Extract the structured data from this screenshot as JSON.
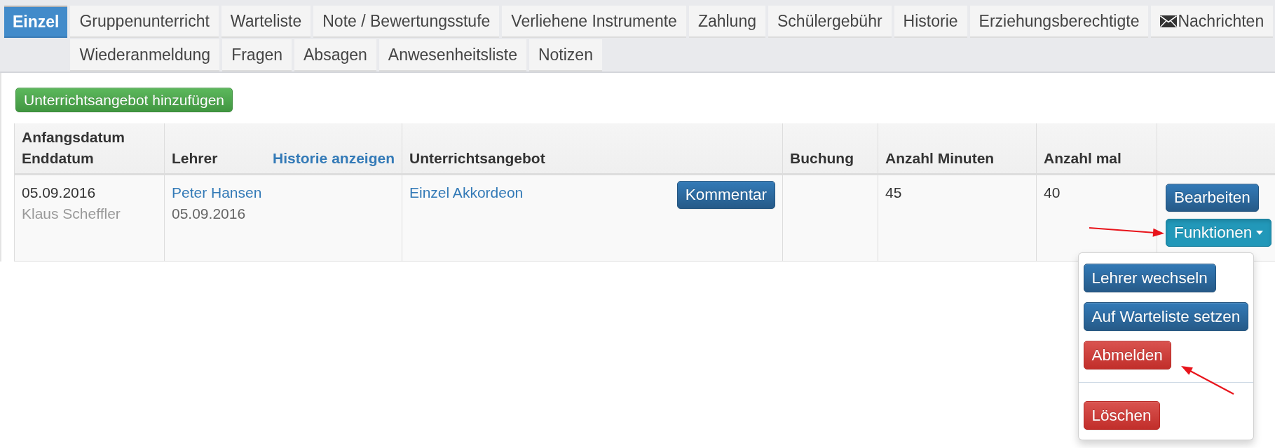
{
  "tab_rows": [
    [
      {
        "label": "Einzel",
        "selected": true,
        "kind": "plain"
      },
      {
        "label": "Gruppenunterricht",
        "selected": false,
        "kind": "plain"
      },
      {
        "label": "Warteliste",
        "selected": false,
        "kind": "plain"
      },
      {
        "label": "Note / Bewertungsstufe",
        "selected": false,
        "kind": "plain"
      },
      {
        "label": "Verliehene Instrumente",
        "selected": false,
        "kind": "plain"
      },
      {
        "label": "Zahlung",
        "selected": false,
        "kind": "plain"
      },
      {
        "label": "Schülergebühr",
        "selected": false,
        "kind": "plain"
      },
      {
        "label": "Historie",
        "selected": false,
        "kind": "plain"
      },
      {
        "label": "Erziehungsberechtigte",
        "selected": false,
        "kind": "plain"
      },
      {
        "label": "Nachrichten",
        "selected": false,
        "kind": "iconed"
      }
    ],
    [
      {
        "label": "Wiederanmeldung",
        "selected": false,
        "kind": "plain"
      },
      {
        "label": "Fragen",
        "selected": false,
        "kind": "plain"
      },
      {
        "label": "Absagen",
        "selected": false,
        "kind": "plain"
      },
      {
        "label": "Anwesenheitsliste",
        "selected": false,
        "kind": "plain"
      },
      {
        "label": "Notizen",
        "selected": false,
        "kind": "plain"
      }
    ]
  ],
  "add_button": {
    "label": "Unterrichtsangebot hinzufügen"
  },
  "table": {
    "columns": [
      {
        "lines": [
          "Anfangsdatum",
          "Enddatum"
        ]
      },
      {
        "lines": [
          "Lehrer"
        ],
        "link": "Historie anzeigen"
      },
      {
        "lines": [
          "Unterrichtsangebot"
        ]
      },
      {
        "lines": [
          "Buchung"
        ]
      },
      {
        "lines": [
          "Anzahl Minuten"
        ]
      },
      {
        "lines": [
          "Anzahl mal"
        ]
      }
    ],
    "rows": [
      {
        "start_date": "05.09.2016",
        "person": "Klaus Scheffler",
        "teacher": "Peter Hansen",
        "teacher_date": "05.09.2016",
        "offer": "Einzel Akkordeon",
        "comment_button": "Kommentar",
        "minutes": "45",
        "times": "40",
        "edit_button": "Bearbeiten",
        "functions": {
          "label": "Funktionen",
          "expanded": true,
          "groups": [
            [
              {
                "label": "Lehrer wechseln",
                "kind": "primary"
              },
              {
                "label": "Auf Warteliste setzen",
                "kind": "primary"
              },
              {
                "label": "Abmelden",
                "kind": "danger"
              }
            ],
            [
              {
                "label": "Löschen",
                "kind": "danger"
              }
            ]
          ]
        }
      }
    ]
  }
}
